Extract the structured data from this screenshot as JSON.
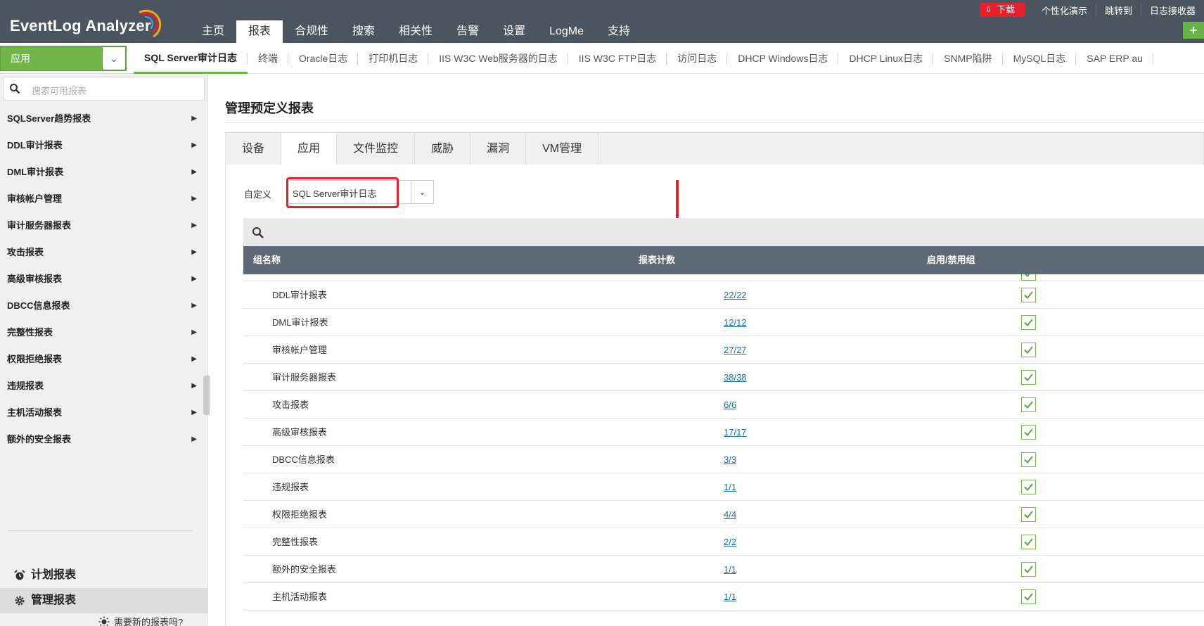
{
  "app": {
    "logo_text": "EventLog Analyzer",
    "colors": {
      "topbar": "#4a5560",
      "accent_green": "#6bb548",
      "download_red": "#e8202e",
      "table_header": "#5d6a75",
      "link_blue": "#1a6ec0"
    }
  },
  "header": {
    "nav": [
      {
        "label": "主页"
      },
      {
        "label": "报表",
        "active": true
      },
      {
        "label": "合规性"
      },
      {
        "label": "搜索"
      },
      {
        "label": "相关性"
      },
      {
        "label": "告警"
      },
      {
        "label": "设置"
      },
      {
        "label": "LogMe"
      },
      {
        "label": "支持"
      }
    ],
    "download_label": "下载",
    "util_links": [
      "个性化演示",
      "跳转到",
      "日志接收器"
    ],
    "plus_label": "+"
  },
  "subbar": {
    "app_select_label": "应用",
    "tabs": [
      {
        "label": "SQL Server审计日志",
        "active": true
      },
      {
        "label": "终端"
      },
      {
        "label": "Oracle日志"
      },
      {
        "label": "打印机日志"
      },
      {
        "label": "IIS W3C Web服务器的日志"
      },
      {
        "label": "IIS W3C FTP日志"
      },
      {
        "label": "访问日志"
      },
      {
        "label": "DHCP Windows日志"
      },
      {
        "label": "DHCP Linux日志"
      },
      {
        "label": "SNMP陷阱"
      },
      {
        "label": "MySQL日志"
      },
      {
        "label": "SAP ERP au"
      }
    ]
  },
  "sidebar": {
    "search_placeholder": "搜索可用报表",
    "items": [
      "SQLServer趋势报表",
      "DDL审计报表",
      "DML审计报表",
      "审核帐户管理",
      "审计服务器报表",
      "攻击报表",
      "高级审核报表",
      "DBCC信息报表",
      "完整性报表",
      "权限拒绝报表",
      "违规报表",
      "主机活动报表",
      "额外的安全报表"
    ],
    "scheduled_reports": "计划报表",
    "manage_reports": "管理报表",
    "need_new_report": "需要新的报表吗?"
  },
  "main": {
    "title": "管理预定义报表",
    "tabs": [
      {
        "label": "设备"
      },
      {
        "label": "应用",
        "active": true
      },
      {
        "label": "文件监控"
      },
      {
        "label": "威胁"
      },
      {
        "label": "漏洞"
      },
      {
        "label": "VM管理"
      }
    ],
    "custom_label": "自定义",
    "custom_select_value": "SQL Server审计日志",
    "table": {
      "headers": {
        "group_name": "组名称",
        "report_count": "报表计数",
        "enable_disable": "启用/禁用组"
      },
      "rows": [
        {
          "name": "DDL审计报表",
          "count": "22/22",
          "enabled": true
        },
        {
          "name": "DML审计报表",
          "count": "12/12",
          "enabled": true
        },
        {
          "name": "审核帐户管理",
          "count": "27/27",
          "enabled": true
        },
        {
          "name": "审计服务器报表",
          "count": "38/38",
          "enabled": true
        },
        {
          "name": "攻击报表",
          "count": "6/6",
          "enabled": true
        },
        {
          "name": "高级审核报表",
          "count": "17/17",
          "enabled": true
        },
        {
          "name": "DBCC信息报表",
          "count": "3/3",
          "enabled": true
        },
        {
          "name": "违规报表",
          "count": "1/1",
          "enabled": true
        },
        {
          "name": "权限拒绝报表",
          "count": "4/4",
          "enabled": true
        },
        {
          "name": "完整性报表",
          "count": "2/2",
          "enabled": true
        },
        {
          "name": "额外的安全报表",
          "count": "1/1",
          "enabled": true
        },
        {
          "name": "主机活动报表",
          "count": "1/1",
          "enabled": true
        }
      ]
    }
  }
}
